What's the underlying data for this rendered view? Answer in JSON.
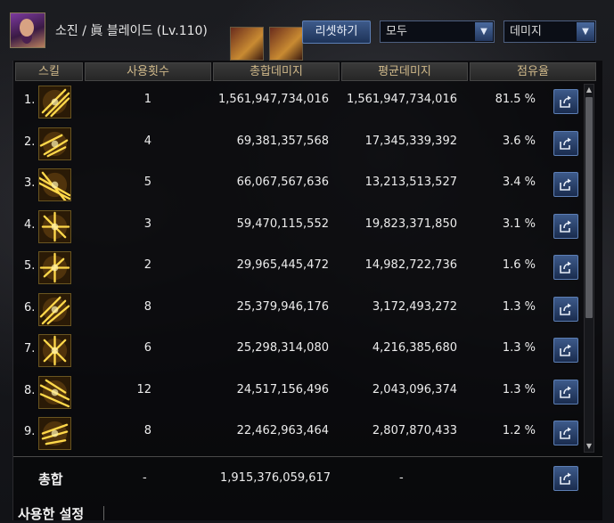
{
  "header": {
    "character": "소진 / 眞 블레이드 (Lv.110)",
    "reset_label": "리셋하기",
    "filter_value": "모두",
    "metric_value": "데미지"
  },
  "columns": [
    "스킬",
    "사용횟수",
    "총합데미지",
    "평균데미지",
    "점유율"
  ],
  "rows": [
    {
      "rank": "1.",
      "count": "1",
      "total": "1,561,947,734,016",
      "avg": "1,561,947,734,016",
      "share": "81.5 %"
    },
    {
      "rank": "2.",
      "count": "4",
      "total": "69,381,357,568",
      "avg": "17,345,339,392",
      "share": "3.6 %"
    },
    {
      "rank": "3.",
      "count": "5",
      "total": "66,067,567,636",
      "avg": "13,213,513,527",
      "share": "3.4 %"
    },
    {
      "rank": "4.",
      "count": "3",
      "total": "59,470,115,552",
      "avg": "19,823,371,850",
      "share": "3.1 %"
    },
    {
      "rank": "5.",
      "count": "2",
      "total": "29,965,445,472",
      "avg": "14,982,722,736",
      "share": "1.6 %"
    },
    {
      "rank": "6.",
      "count": "8",
      "total": "25,379,946,176",
      "avg": "3,172,493,272",
      "share": "1.3 %"
    },
    {
      "rank": "7.",
      "count": "6",
      "total": "25,298,314,080",
      "avg": "4,216,385,680",
      "share": "1.3 %"
    },
    {
      "rank": "8.",
      "count": "12",
      "total": "24,517,156,496",
      "avg": "2,043,096,374",
      "share": "1.3 %"
    },
    {
      "rank": "9.",
      "count": "8",
      "total": "22,462,963,464",
      "avg": "2,807,870,433",
      "share": "1.2 %"
    }
  ],
  "totals": {
    "label": "총합",
    "count": "-",
    "total": "1,915,376,059,617",
    "avg": "-"
  },
  "footer": {
    "settings_label": "사용한 설정"
  },
  "colors": {
    "accent_blue": "#3d5a8a",
    "header_gold": "#d0b98a",
    "skill_gold": "#f2c230"
  }
}
